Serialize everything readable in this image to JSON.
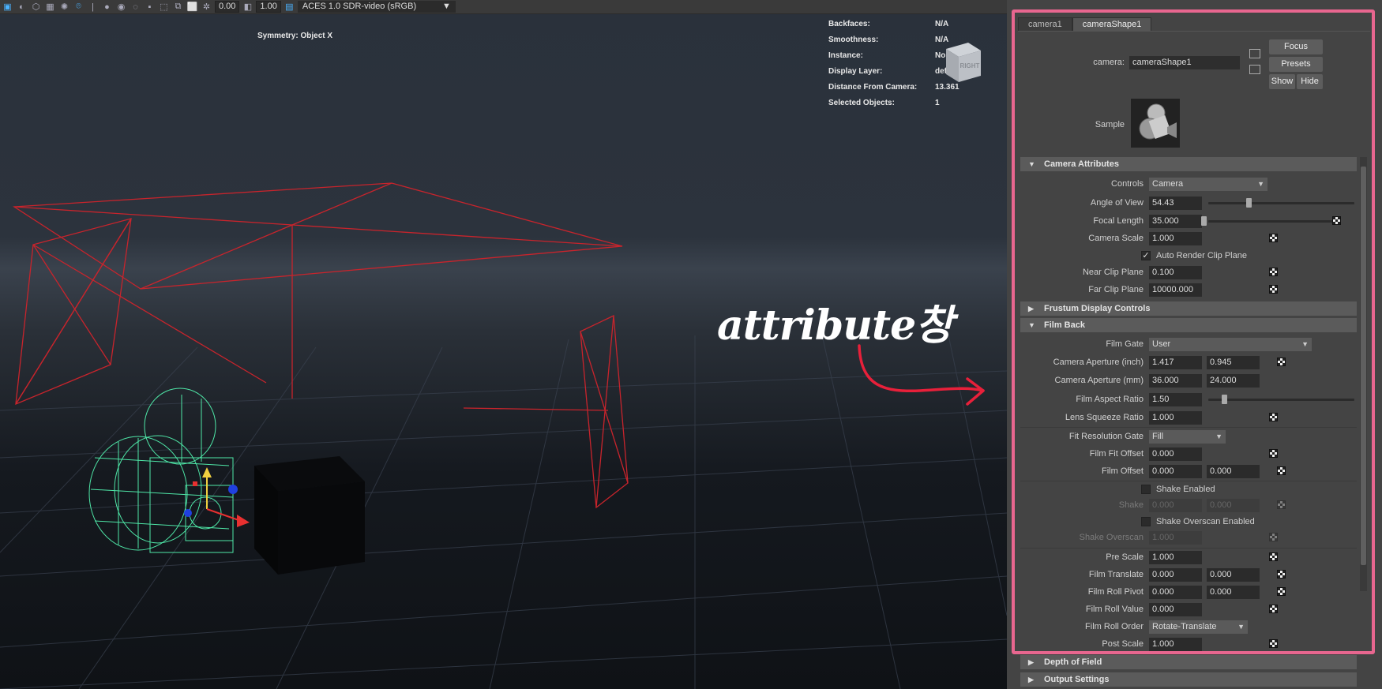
{
  "toolbar": {
    "exposure_value": "0.00",
    "gamma_value": "1.00",
    "color_space": "ACES 1.0 SDR-video (sRGB)"
  },
  "hud": {
    "symmetry": "Symmetry: Object X",
    "rows": [
      {
        "key": "Backfaces:",
        "value": "N/A"
      },
      {
        "key": "Smoothness:",
        "value": "N/A"
      },
      {
        "key": "Instance:",
        "value": "No"
      },
      {
        "key": "Display Layer:",
        "value": "default"
      },
      {
        "key": "Distance From Camera:",
        "value": "13.361"
      },
      {
        "key": "Selected Objects:",
        "value": "1"
      }
    ],
    "viewcube_label": "RIGHT"
  },
  "annotation": {
    "label": "attribute창",
    "color": "#e8203a"
  },
  "attribute_editor": {
    "tabs": [
      "camera1",
      "cameraShape1"
    ],
    "active_tab": "cameraShape1",
    "camera_label": "camera:",
    "camera_value": "cameraShape1",
    "buttons": {
      "focus": "Focus",
      "presets": "Presets",
      "show": "Show",
      "hide": "Hide"
    },
    "sample_label": "Sample",
    "sections": {
      "camera_attributes": "Camera Attributes",
      "frustum": "Frustum Display Controls",
      "film_back": "Film Back",
      "depth_of_field": "Depth of Field",
      "output_settings": "Output Settings"
    },
    "camera_attributes": {
      "controls_label": "Controls",
      "controls_value": "Camera",
      "angle_label": "Angle of View",
      "angle_value": "54.43",
      "focal_label": "Focal Length",
      "focal_value": "35.000",
      "scale_label": "Camera Scale",
      "scale_value": "1.000",
      "auto_clip_label": "Auto Render Clip Plane",
      "near_label": "Near Clip Plane",
      "near_value": "0.100",
      "far_label": "Far Clip Plane",
      "far_value": "10000.000"
    },
    "film_back": {
      "gate_label": "Film Gate",
      "gate_value": "User",
      "ap_inch_label": "Camera Aperture (inch)",
      "ap_inch_1": "1.417",
      "ap_inch_2": "0.945",
      "ap_mm_label": "Camera Aperture (mm)",
      "ap_mm_1": "36.000",
      "ap_mm_2": "24.000",
      "aspect_label": "Film Aspect Ratio",
      "aspect_value": "1.50",
      "squeeze_label": "Lens Squeeze Ratio",
      "squeeze_value": "1.000",
      "fitgate_label": "Fit Resolution Gate",
      "fitgate_value": "Fill",
      "fitoffset_label": "Film Fit Offset",
      "fitoffset_value": "0.000",
      "offset_label": "Film Offset",
      "offset_1": "0.000",
      "offset_2": "0.000",
      "shake_enabled_label": "Shake Enabled",
      "shake_label": "Shake",
      "shake_1": "0.000",
      "shake_2": "0.000",
      "shake_overscan_enabled_label": "Shake Overscan Enabled",
      "shake_overscan_label": "Shake Overscan",
      "shake_overscan_value": "1.000",
      "prescale_label": "Pre Scale",
      "prescale_value": "1.000",
      "translate_label": "Film Translate",
      "translate_1": "0.000",
      "translate_2": "0.000",
      "rollpivot_label": "Film Roll Pivot",
      "rollpivot_1": "0.000",
      "rollpivot_2": "0.000",
      "rollvalue_label": "Film Roll Value",
      "rollvalue_value": "0.000",
      "rollorder_label": "Film Roll Order",
      "rollorder_value": "Rotate-Translate",
      "postscale_label": "Post Scale",
      "postscale_value": "1.000"
    },
    "frame_color": "#e8668f"
  }
}
